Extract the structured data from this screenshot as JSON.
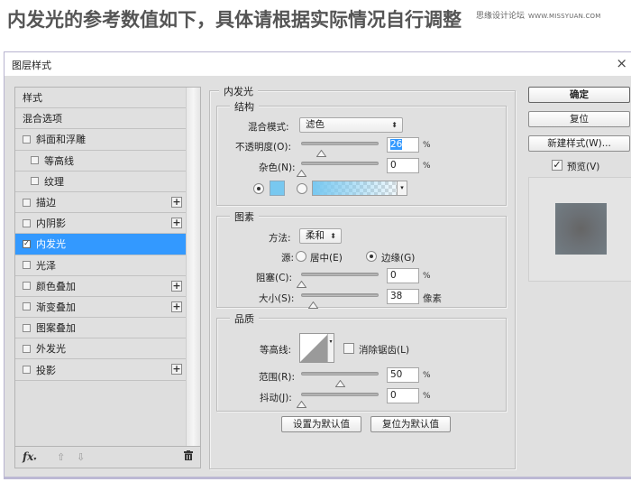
{
  "headline": "内发光的参考数值如下，具体请根据实际情况自行调整",
  "watermark": {
    "site": "思缘设计论坛",
    "url": "WWW.MISSYUAN.COM"
  },
  "dialog": {
    "title": "图层样式",
    "close_icon": "×",
    "style_list": [
      {
        "label": "样式",
        "checkbox": false,
        "plus": false,
        "indent": false
      },
      {
        "label": "混合选项",
        "checkbox": false,
        "plus": false,
        "indent": false
      },
      {
        "label": "斜面和浮雕",
        "checkbox": true,
        "checked": false,
        "plus": false,
        "indent": false
      },
      {
        "label": "等高线",
        "checkbox": true,
        "checked": false,
        "plus": false,
        "indent": true
      },
      {
        "label": "纹理",
        "checkbox": true,
        "checked": false,
        "plus": false,
        "indent": true
      },
      {
        "label": "描边",
        "checkbox": true,
        "checked": false,
        "plus": true,
        "indent": false
      },
      {
        "label": "内阴影",
        "checkbox": true,
        "checked": false,
        "plus": true,
        "indent": false
      },
      {
        "label": "内发光",
        "checkbox": true,
        "checked": true,
        "plus": false,
        "indent": false,
        "selected": true
      },
      {
        "label": "光泽",
        "checkbox": true,
        "checked": false,
        "plus": false,
        "indent": false
      },
      {
        "label": "颜色叠加",
        "checkbox": true,
        "checked": false,
        "plus": true,
        "indent": false
      },
      {
        "label": "渐变叠加",
        "checkbox": true,
        "checked": false,
        "plus": true,
        "indent": false
      },
      {
        "label": "图案叠加",
        "checkbox": true,
        "checked": false,
        "plus": false,
        "indent": false
      },
      {
        "label": "外发光",
        "checkbox": true,
        "checked": false,
        "plus": false,
        "indent": false
      },
      {
        "label": "投影",
        "checkbox": true,
        "checked": false,
        "plus": true,
        "indent": false
      }
    ],
    "list_footer": {
      "fx": "fx",
      "up": "⇧",
      "down": "⇩",
      "trash": "🗑"
    },
    "panel": {
      "title": "内发光",
      "structure": {
        "title": "结构",
        "blend_mode_label": "混合模式:",
        "blend_mode_value": "滤色",
        "opacity_label": "不透明度(O):",
        "opacity_value": "26",
        "opacity_unit": "%",
        "noise_label": "杂色(N):",
        "noise_value": "0",
        "noise_unit": "%",
        "color_mode": "solid",
        "color_hex": "#78c8f0"
      },
      "elements": {
        "title": "图素",
        "method_label": "方法:",
        "method_value": "柔和",
        "source_label": "源:",
        "source_center": "居中(E)",
        "source_edge": "边缘(G)",
        "source_selected": "edge",
        "choke_label": "阻塞(C):",
        "choke_value": "0",
        "choke_unit": "%",
        "size_label": "大小(S):",
        "size_value": "38",
        "size_unit": "像素"
      },
      "quality": {
        "title": "品质",
        "contour_label": "等高线:",
        "antialias_label": "消除锯齿(L)",
        "antialias_checked": false,
        "range_label": "范围(R):",
        "range_value": "50",
        "range_unit": "%",
        "jitter_label": "抖动(J):",
        "jitter_value": "0",
        "jitter_unit": "%"
      },
      "set_default": "设置为默认值",
      "reset_default": "复位为默认值"
    },
    "buttons": {
      "ok": "确定",
      "reset": "复位",
      "new_style": "新建样式(W)...",
      "preview_label": "预览(V)",
      "preview_checked": true
    },
    "sliders": {
      "opacity": 0.26,
      "noise": 0.0,
      "choke": 0.0,
      "size": 0.15,
      "range": 0.5,
      "jitter": 0.0
    }
  }
}
